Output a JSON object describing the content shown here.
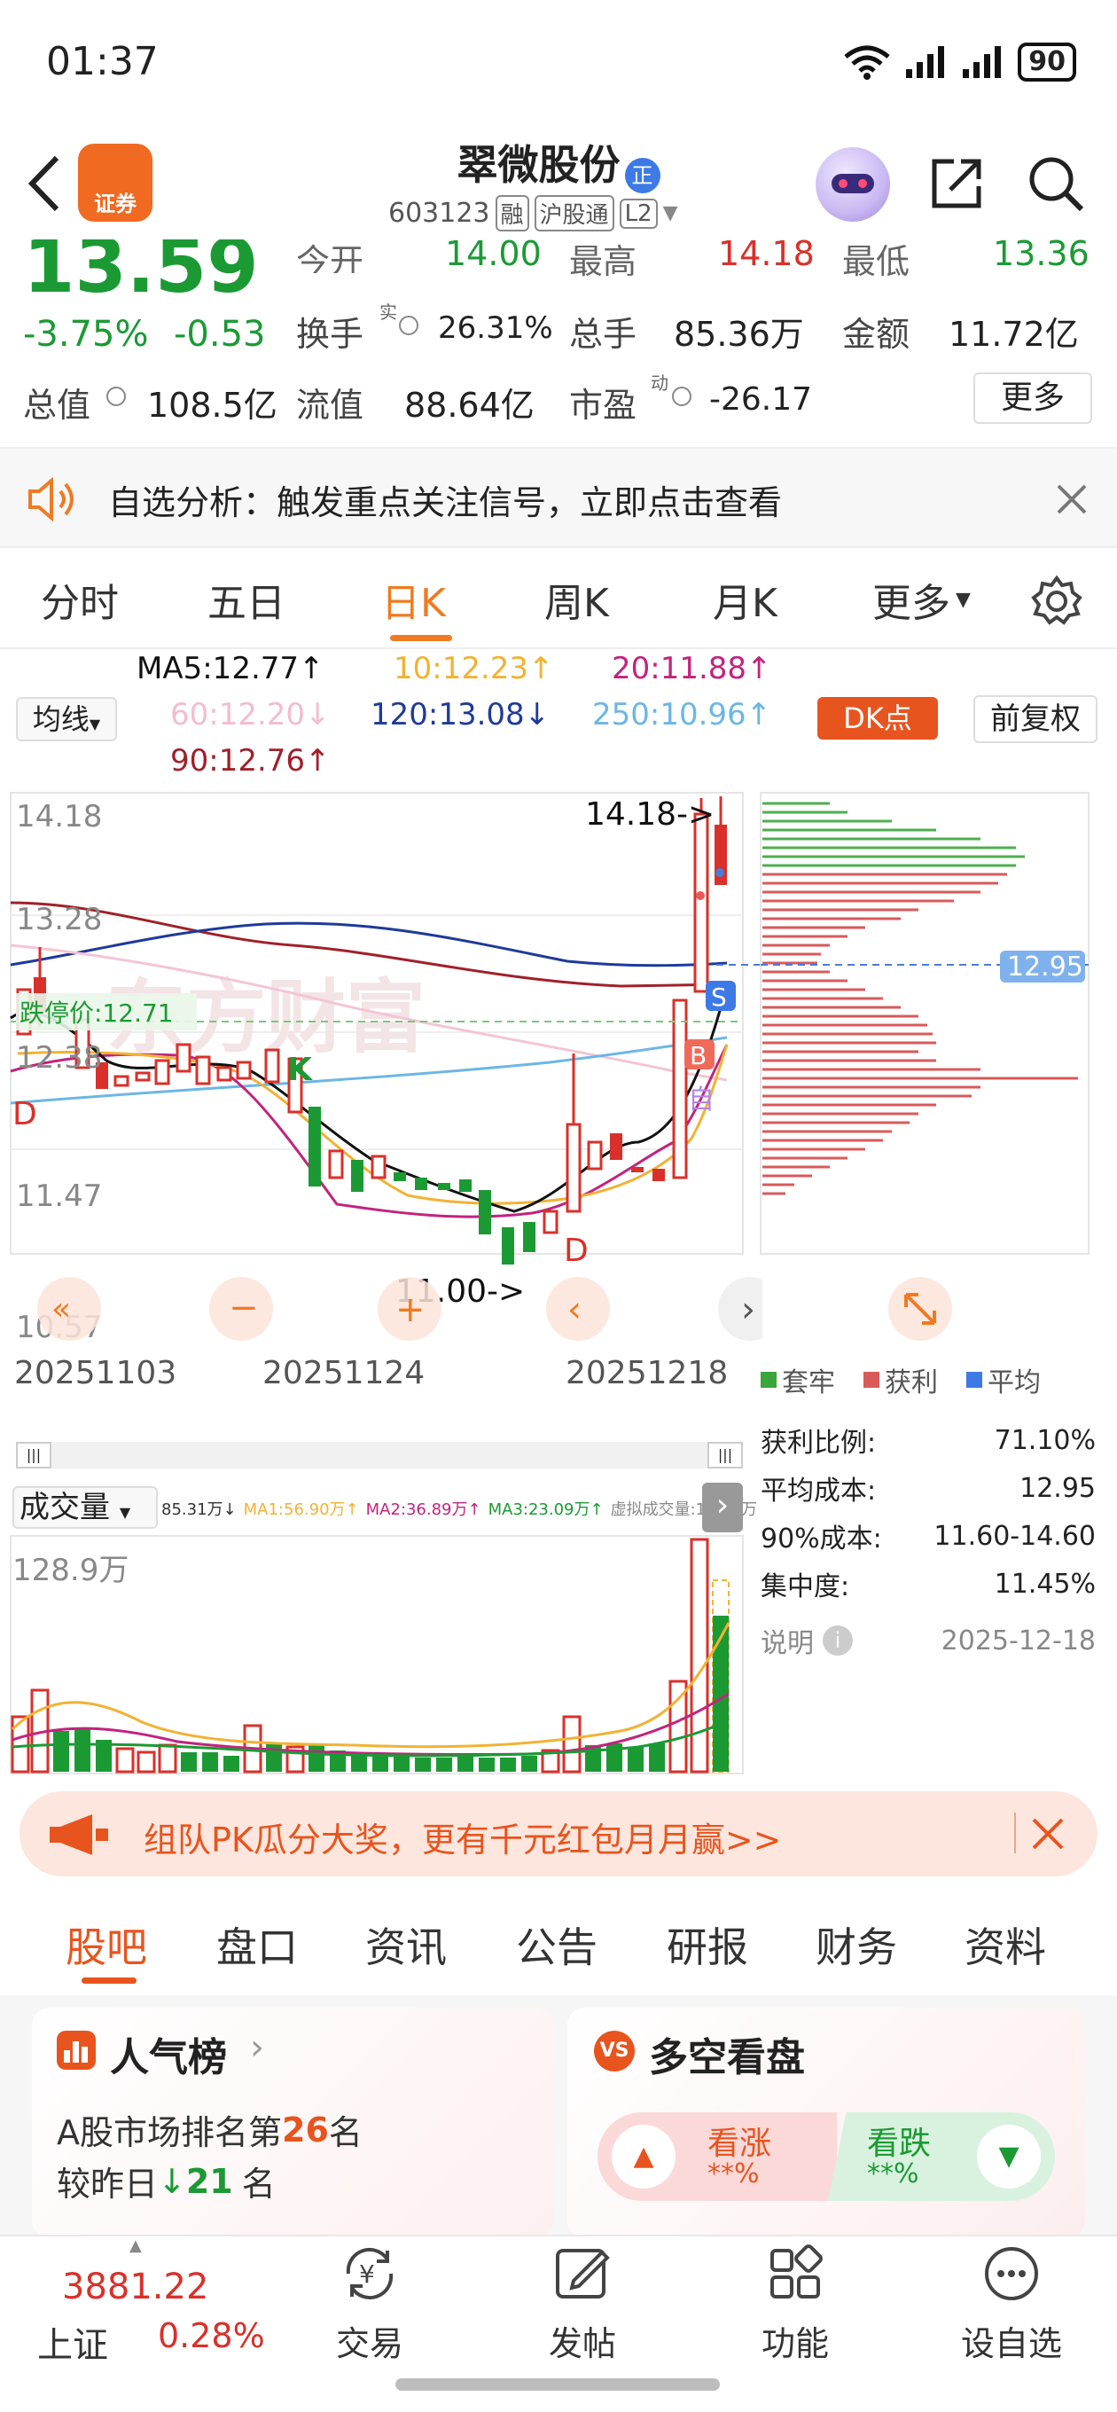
{
  "status_bar": {
    "time": "01:37",
    "battery": "90"
  },
  "header": {
    "title": "翠微股份",
    "badge": "正",
    "code": "603123",
    "tags": [
      "融",
      "沪股通",
      "L2"
    ]
  },
  "quote": {
    "price": "13.59",
    "change_pct": "-3.75%",
    "change_abs": "-0.53",
    "open_label": "今开",
    "open": "14.00",
    "high_label": "最高",
    "high": "14.18",
    "low_label": "最低",
    "low": "13.36",
    "turnover_label": "换手",
    "turnover_sup": "实",
    "turnover": "26.31%",
    "volume_label": "总手",
    "volume": "85.36万",
    "amount_label": "金额",
    "amount": "11.72亿",
    "mktcap_label": "总值",
    "mktcap": "108.5亿",
    "float_label": "流值",
    "float_cap": "88.64亿",
    "pe_label": "市盈",
    "pe_sup": "动",
    "pe": "-26.17",
    "more_label": "更多"
  },
  "alert": {
    "text": "自选分析：触发重点关注信号，立即点击查看"
  },
  "chart_tabs": {
    "items": [
      "分时",
      "五日",
      "日K",
      "周K",
      "月K",
      "更多"
    ],
    "active": 2
  },
  "indicators": {
    "selector": "均线",
    "ma5": "MA5:12.77↑",
    "ma10": "10:12.23↑",
    "ma20": "20:11.88↑",
    "ma60": "60:12.20↓",
    "ma120": "120:13.08↓",
    "ma250": "250:10.96↑",
    "ma90": "90:12.76↑",
    "dk_label": "DK点",
    "adjust_label": "前复权"
  },
  "kline": {
    "y_labels": [
      "14.18",
      "13.28",
      "12.38",
      "11.47",
      "10.57"
    ],
    "x_labels": [
      "20251103",
      "20251124",
      "20251218"
    ],
    "limit_down_label": "跌停价:12.71",
    "high_marker": "14.18->",
    "low_marker": "11.00->",
    "avg_cost_tag": "12.95",
    "signals": {
      "k": "K",
      "d1": "D",
      "d2": "D",
      "b": "B",
      "s": "S",
      "zi": "自"
    }
  },
  "chip": {
    "legend": [
      "套牢",
      "获利",
      "平均"
    ],
    "rows": [
      {
        "label": "获利比例:",
        "value": "71.10%"
      },
      {
        "label": "平均成本:",
        "value": "12.95"
      },
      {
        "label": "90%成本:",
        "value": "11.60-14.60"
      },
      {
        "label": "集中度:",
        "value": "11.45%"
      }
    ],
    "note_label": "说明",
    "date": "2025-12-18"
  },
  "volume": {
    "selector": "成交量",
    "legend": [
      "85.31万↓",
      "MA1:56.90万↑",
      "MA2:36.89万↑",
      "MA3:23.09万↑",
      "虚拟成交量:115.9万"
    ],
    "max_label": "128.9万"
  },
  "banner": {
    "text": "组队PK瓜分大奖，更有千元红包月月赢>>"
  },
  "sub_tabs": {
    "items": [
      "股吧",
      "盘口",
      "资讯",
      "公告",
      "研报",
      "财务",
      "资料"
    ],
    "active": 0
  },
  "popularity": {
    "title": "人气榜",
    "rank_prefix": "A股市场排名第",
    "rank": "26",
    "rank_suffix": "名",
    "change_prefix": "较昨日",
    "change": "21",
    "change_suffix": "名"
  },
  "bullbear": {
    "title": "多空看盘",
    "up_label": "看涨",
    "up_value": "**%",
    "down_label": "看跌",
    "down_value": "**%"
  },
  "bottom_nav": {
    "index_value": "3881.22",
    "index_name": "上证",
    "index_change": "0.28%",
    "items": [
      "交易",
      "发帖",
      "功能",
      "设自选"
    ]
  },
  "colors": {
    "up": "#d9302a",
    "down": "#1b9a34",
    "accent": "#f07a22",
    "ma5": "#111111",
    "ma10": "#f2b233",
    "ma20": "#c2237e",
    "ma120": "#1e3a9a",
    "ma250": "#6cb6e6",
    "ma90": "#a0202a",
    "ma60": "#f3c5d6"
  }
}
